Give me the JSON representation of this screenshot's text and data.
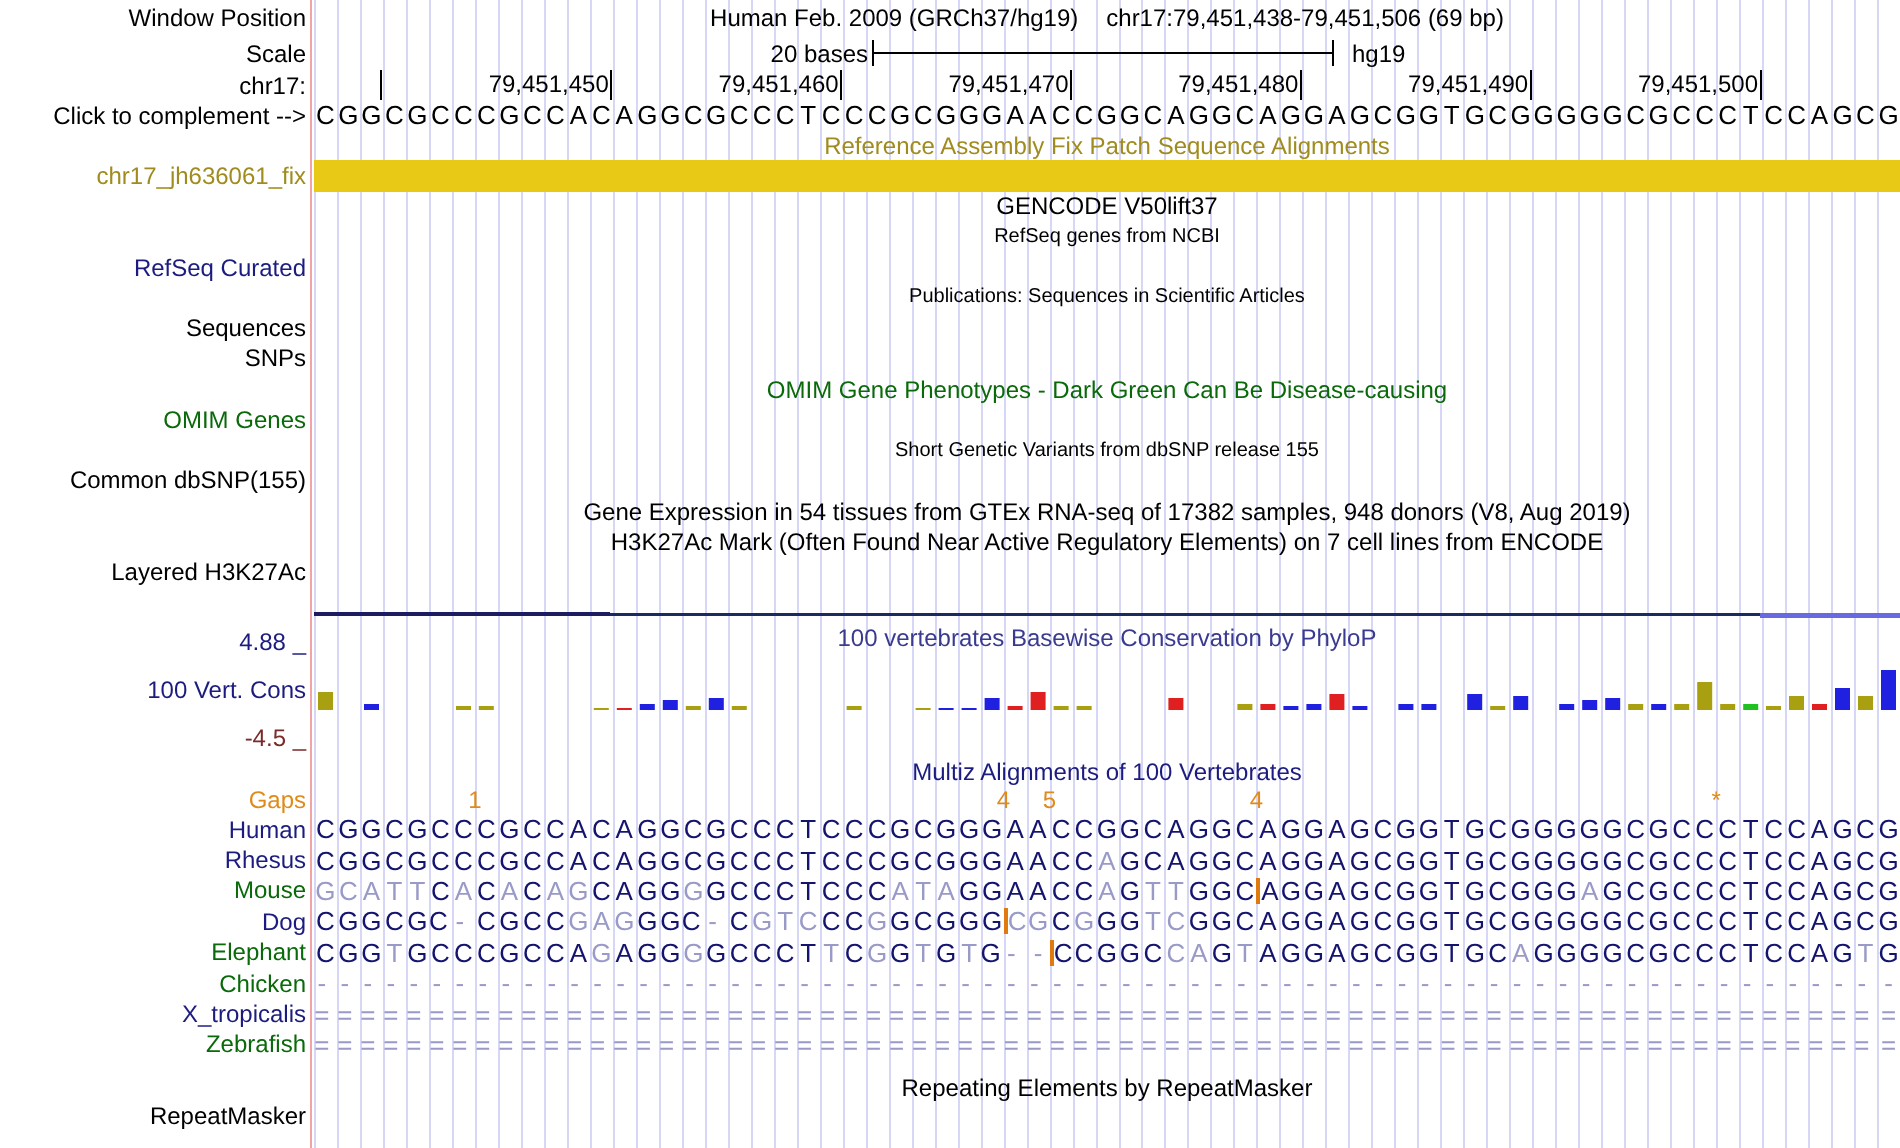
{
  "position": {
    "label": "Window Position",
    "assembly": "Human Feb. 2009 (GRCh37/hg19)",
    "range": "chr17:79,451,438-79,451,506 (69 bp)"
  },
  "scale": {
    "label": "Scale",
    "size": "20 bases",
    "db": "hg19"
  },
  "ruler": {
    "label": "chr17:",
    "ticks": [
      "79,451,450",
      "79,451,460",
      "79,451,470",
      "79,451,480",
      "79,451,490",
      "79,451,500"
    ]
  },
  "sequence": {
    "label": "Click to complement -->",
    "bases": "CGGCGCCCGCCACAGGCGCCCTCCCGCGGGAACCGGCAGGCAGGAGCGGTGCGGGGGCGCCCTCCAGCG"
  },
  "tracks": [
    {
      "kind": "title",
      "text": "Reference Assembly Fix Patch Sequence Alignments",
      "color": "#a08c1e"
    },
    {
      "kind": "bar",
      "text": "chr17_jh636061_fix",
      "color": "#a08c1e"
    },
    {
      "kind": "title",
      "text": "GENCODE V50lift37",
      "color": "#000000"
    },
    {
      "kind": "subtitle",
      "text": "RefSeq genes from NCBI",
      "color": "#000000"
    },
    {
      "kind": "label",
      "text": "RefSeq Curated",
      "color": "#1c1c80"
    },
    {
      "kind": "subtitle",
      "text": "Publications: Sequences in Scientific Articles",
      "color": "#000000"
    },
    {
      "kind": "label",
      "text": "Sequences",
      "color": "#000000"
    },
    {
      "kind": "label",
      "text": "SNPs",
      "color": "#000000"
    },
    {
      "kind": "title",
      "text": "OMIM Gene Phenotypes - Dark Green Can Be Disease-causing",
      "color": "#0a6a0a"
    },
    {
      "kind": "label",
      "text": "OMIM Genes",
      "color": "#0a6a0a"
    },
    {
      "kind": "subtitle",
      "text": "Short Genetic Variants from dbSNP release 155",
      "color": "#000000"
    },
    {
      "kind": "label",
      "text": "Common dbSNP(155)",
      "color": "#000000"
    },
    {
      "kind": "title",
      "text": "Gene Expression in 54 tissues from GTEx RNA-seq of 17382 samples, 948 donors (V8, Aug 2019)",
      "color": "#000000"
    },
    {
      "kind": "title",
      "text": "H3K27Ac Mark (Often Found Near Active Regulatory Elements) on 7 cell lines from ENCODE",
      "color": "#000000"
    },
    {
      "kind": "label",
      "text": "Layered H3K27Ac",
      "color": "#000000"
    },
    {
      "kind": "line"
    }
  ],
  "conservation": {
    "title": "100 vertebrates Basewise Conservation by PhyloP",
    "label": "100 Vert. Cons",
    "max": "4.88 _",
    "min": "-4.5 _"
  },
  "multiz": {
    "title": "Multiz Alignments of 100 Vertebrates",
    "gaps_label": "Gaps",
    "gaps": [
      "1",
      "4",
      "5",
      "4",
      "*"
    ],
    "species": [
      {
        "name": "Human",
        "color": "#1c1c80",
        "bases": "CGGCGCCCGCCACAGGCGCCCTCCCGCGGGAACCGGCAGGCAGGAGCGGTGCGGGGGCGCCCTCCAGCG"
      },
      {
        "name": "Rhesus",
        "color": "#1c1c80",
        "bases": "CGGCGCCCGCCACAGGCGCCCTCCCGCGGGAACCAGCAGGCAGGAGCGGTGCGGGGGCGCCCTCCAGCG"
      },
      {
        "name": "Mouse",
        "color": "#0a6a0a",
        "bases": [
          "GCATTCACACAGCAGGGGCCCTCCCATAGGAACCAGTTGGC",
          "AGGAGCGGTGCGGGAGCGCCCTCCAGCG"
        ]
      },
      {
        "name": "Dog",
        "color": "#1c1c80",
        "bases": [
          "CGGCGC - CGCCGAGGGC - CGTCCCGGCGGG",
          "CGCGGGTCGGCAGGAGCGGTGCGGGGGCGCCCTCCAGCG"
        ]
      },
      {
        "name": "Elephant",
        "color": "#0a6a0a",
        "bases": [
          "CGGTGCCCGCCAGAGGGGCCCTTCGGTGTG - -",
          "CCGGCCAGTAGGAGCGGTGCAGGGGCGCCCTCCAGTG"
        ]
      },
      {
        "name": "Chicken",
        "color": "#0a6a0a",
        "bases": "- - - - - - - - - - - - - - - - - - - - - - - - - - - - - - - - - - - - - - - - - - - - - - - - - - - - - - - - - - - - - - - - - - - - -"
      },
      {
        "name": "X_tropicalis",
        "color": "#1c1c80",
        "bases": "= = = = = = = = = = = = = = = = = = = = = = = = = = = = = = = = = = = = = = = = = = = = = = = = = = = = = = = = = = = = = = = = = = = = ="
      },
      {
        "name": "Zebrafish",
        "color": "#0a6a0a",
        "bases": "= = = = = = = = = = = = = = = = = = = = = = = = = = = = = = = = = = = = = = = = = = = = = = = = = = = = = = = = = = = = = = = = = = = = ="
      }
    ]
  },
  "bottom_tracks": [
    {
      "kind": "title",
      "text": "Repeating Elements by RepeatMasker",
      "color": "#000000"
    },
    {
      "kind": "label",
      "text": "RepeatMasker",
      "color": "#000000"
    }
  ]
}
